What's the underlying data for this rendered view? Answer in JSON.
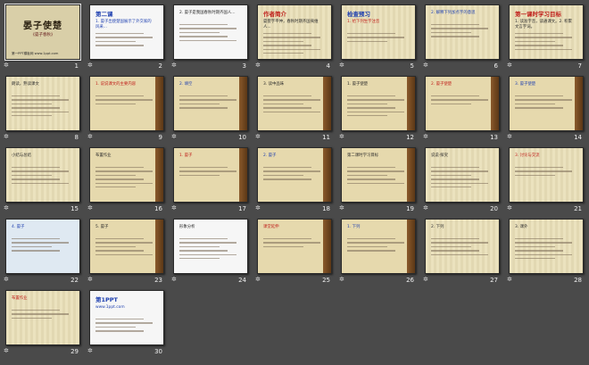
{
  "slides": [
    {
      "num": "1",
      "title": "晏子使楚",
      "subtitle": "《晏子春秋》",
      "text": "第一PPT模板网 www.1ppt.com",
      "theme": "t-title"
    },
    {
      "num": "2",
      "title": "第二课",
      "text": "1. 晏子出使楚国展示了外交家的风采...",
      "theme": "t-white"
    },
    {
      "num": "3",
      "title": "",
      "text": "2. 晏子是我国春秋时期齐国人...",
      "theme": "t-white"
    },
    {
      "num": "4",
      "title": "作者简介",
      "text": "晏婴字平仲，春秋时期齐国夷维人...",
      "theme": "t-paper"
    },
    {
      "num": "5",
      "title": "检查预习",
      "text": "1. 给下列生字注音",
      "theme": "t-paper"
    },
    {
      "num": "6",
      "title": "",
      "text": "2. 解释下列加点字的意思",
      "theme": "t-paper"
    },
    {
      "num": "7",
      "title": "第一课时学习目标",
      "text": "1. 读准字音，读通课文。2. 积累文言字词。",
      "theme": "t-paper"
    },
    {
      "num": "8",
      "title": "",
      "text": "朗读，熟读课文",
      "theme": "t-paper"
    },
    {
      "num": "9",
      "title": "",
      "text": "1. 说说课文的主要内容",
      "theme": "t-wood"
    },
    {
      "num": "10",
      "title": "",
      "text": "2. 填空",
      "theme": "t-wood"
    },
    {
      "num": "11",
      "title": "",
      "text": "3. 读中品味",
      "theme": "t-wood"
    },
    {
      "num": "12",
      "title": "",
      "text": "1. 晏子使楚",
      "theme": "t-wood"
    },
    {
      "num": "13",
      "title": "",
      "text": "2. 晏子使楚",
      "theme": "t-wood"
    },
    {
      "num": "14",
      "title": "",
      "text": "3. 晏子使楚",
      "theme": "t-wood"
    },
    {
      "num": "15",
      "title": "",
      "text": "小结与总结",
      "theme": "t-paper"
    },
    {
      "num": "16",
      "title": "",
      "text": "布置作业",
      "theme": "t-wood"
    },
    {
      "num": "17",
      "title": "",
      "text": "1. 晏子",
      "theme": "t-wood"
    },
    {
      "num": "18",
      "title": "",
      "text": "2. 晏子",
      "theme": "t-wood"
    },
    {
      "num": "19",
      "title": "",
      "text": "第二课时学习目标",
      "theme": "t-wood"
    },
    {
      "num": "20",
      "title": "",
      "text": "说说·探究",
      "theme": "t-paper"
    },
    {
      "num": "21",
      "title": "",
      "text": "3. 讨论与交流",
      "theme": "t-paper"
    },
    {
      "num": "22",
      "title": "",
      "text": "4. 晏子",
      "theme": "t-blue"
    },
    {
      "num": "23",
      "title": "",
      "text": "5. 晏子",
      "theme": "t-wood"
    },
    {
      "num": "24",
      "title": "",
      "text": "形象分析",
      "theme": "t-white"
    },
    {
      "num": "25",
      "title": "",
      "text": "课堂延伸",
      "theme": "t-wood"
    },
    {
      "num": "26",
      "title": "",
      "text": "1. 下列",
      "theme": "t-wood"
    },
    {
      "num": "27",
      "title": "",
      "text": "2. 下列",
      "theme": "t-paper"
    },
    {
      "num": "28",
      "title": "",
      "text": "3. 课外",
      "theme": "t-paper"
    },
    {
      "num": "29",
      "title": "",
      "text": "布置作业",
      "theme": "t-paper"
    },
    {
      "num": "30",
      "title": "第1PPT",
      "text": "www.1ppt.com",
      "theme": "t-white"
    }
  ],
  "colors": {
    "bg": "#4a4a4a",
    "accent_red": "#c0201b",
    "accent_blue": "#1d3fb0"
  }
}
